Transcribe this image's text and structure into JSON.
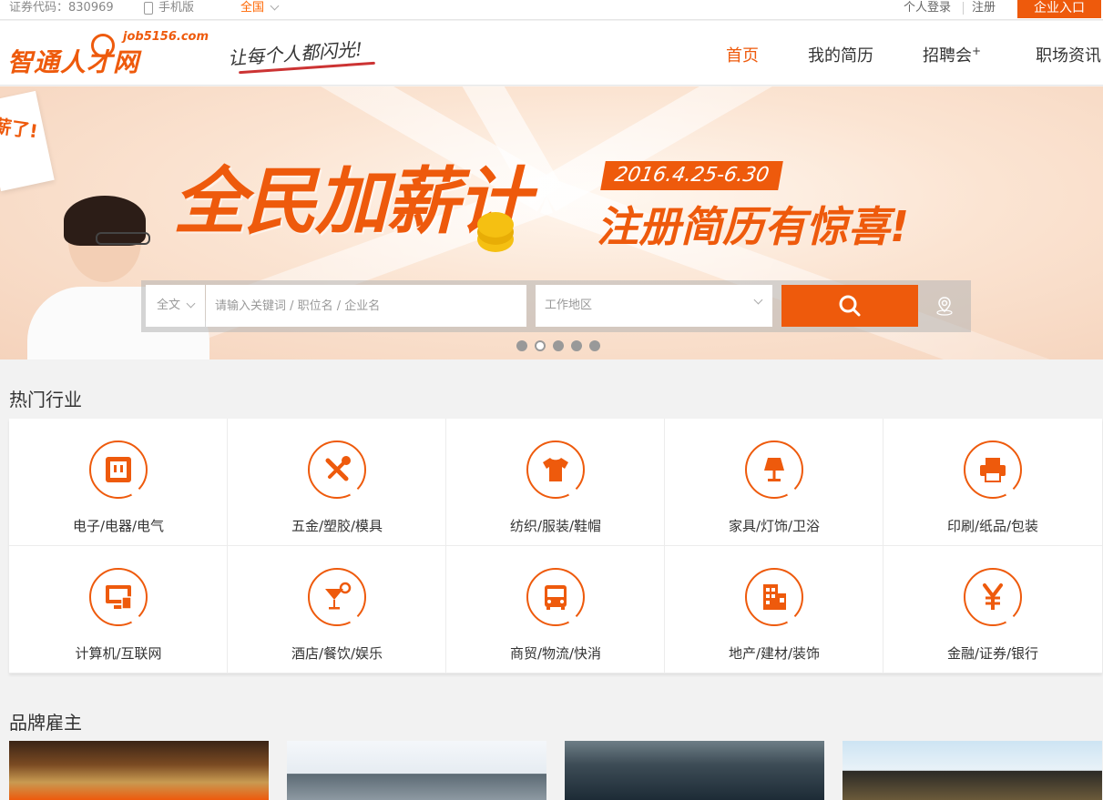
{
  "topbar": {
    "stock_code": "证券代码：830969",
    "mobile": "手机版",
    "region": "全国",
    "login": "个人登录",
    "register": "注册",
    "corp_entry": "企业入口"
  },
  "header": {
    "logo_text": "智通人才网",
    "logo_url": "job5156.com",
    "slogan": "让每个人都闪光!",
    "nav": [
      {
        "label": "首页",
        "active": true
      },
      {
        "label": "我的简历",
        "active": false
      },
      {
        "label": "招聘会",
        "suffix": "+",
        "active": false
      },
      {
        "label": "职场资讯",
        "active": false
      }
    ]
  },
  "banner": {
    "paper_text": "薪了!",
    "title": "全民加薪计",
    "date": "2016.4.25-6.30",
    "subtitle": "注册简历有惊喜!",
    "slide_count": 5,
    "active_slide": 2
  },
  "search": {
    "type": "全文",
    "placeholder": "请输入关键词 / 职位名 / 企业名",
    "area": "工作地区",
    "button_icon": "search-icon",
    "location_icon": "location-pin-icon"
  },
  "industries": {
    "title": "热门行业",
    "items": [
      {
        "label": "电子/电器/电气",
        "icon": "socket-icon"
      },
      {
        "label": "五金/塑胶/模具",
        "icon": "tools-icon"
      },
      {
        "label": "纺织/服装/鞋帽",
        "icon": "shirt-icon"
      },
      {
        "label": "家具/灯饰/卫浴",
        "icon": "lamp-icon"
      },
      {
        "label": "印刷/纸品/包装",
        "icon": "printer-icon"
      },
      {
        "label": "计算机/互联网",
        "icon": "computer-icon"
      },
      {
        "label": "酒店/餐饮/娱乐",
        "icon": "cocktail-icon"
      },
      {
        "label": "商贸/物流/快消",
        "icon": "bus-icon"
      },
      {
        "label": "地产/建材/装饰",
        "icon": "building-icon"
      },
      {
        "label": "金融/证券/银行",
        "icon": "yen-icon"
      }
    ]
  },
  "brands": {
    "title": "品牌雇主"
  },
  "colors": {
    "accent": "#ee5a0c",
    "background": "#f2f2f2"
  }
}
